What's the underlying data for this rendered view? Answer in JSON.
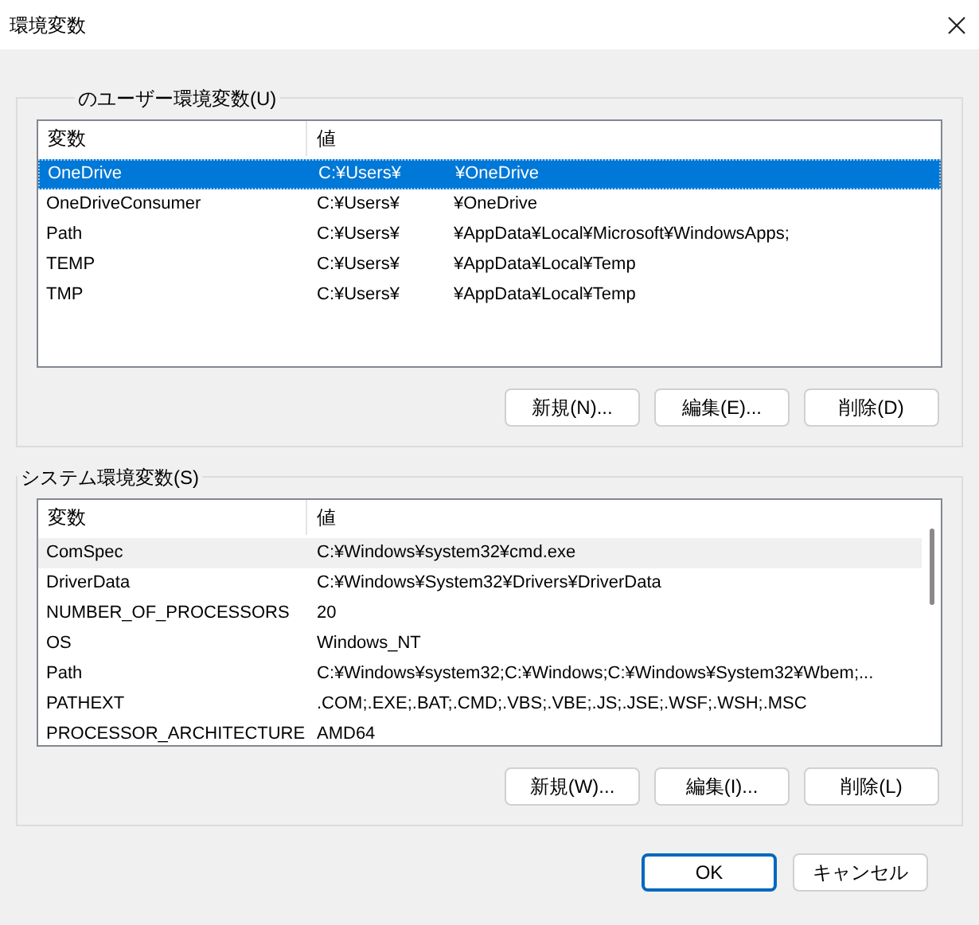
{
  "window": {
    "title": "環境変数"
  },
  "user_group": {
    "title": "のユーザー環境変数(U)",
    "columns": [
      "変数",
      "値"
    ],
    "rows": [
      {
        "name": "OneDrive",
        "value": [
          "C:¥Users¥",
          "¥OneDrive"
        ],
        "selected": true
      },
      {
        "name": "OneDriveConsumer",
        "value": [
          "C:¥Users¥",
          "¥OneDrive"
        ],
        "selected": false
      },
      {
        "name": "Path",
        "value": [
          "C:¥Users¥",
          "¥AppData¥Local¥Microsoft¥WindowsApps;"
        ],
        "selected": false
      },
      {
        "name": "TEMP",
        "value": [
          "C:¥Users¥",
          "¥AppData¥Local¥Temp"
        ],
        "selected": false
      },
      {
        "name": "TMP",
        "value": [
          "C:¥Users¥",
          "¥AppData¥Local¥Temp"
        ],
        "selected": false
      }
    ],
    "buttons": [
      "新規(N)...",
      "編集(E)...",
      "削除(D)"
    ]
  },
  "system_group": {
    "title": "システム環境変数(S)",
    "columns": [
      "変数",
      "値"
    ],
    "rows": [
      {
        "name": "ComSpec",
        "value": [
          "C:¥Windows¥system32¥cmd.exe"
        ],
        "hovered": true
      },
      {
        "name": "DriverData",
        "value": [
          "C:¥Windows¥System32¥Drivers¥DriverData"
        ],
        "hovered": false
      },
      {
        "name": "NUMBER_OF_PROCESSORS",
        "value": [
          "20"
        ],
        "hovered": false
      },
      {
        "name": "OS",
        "value": [
          "Windows_NT"
        ],
        "hovered": false
      },
      {
        "name": "Path",
        "value": [
          "C:¥Windows¥system32;C:¥Windows;C:¥Windows¥System32¥Wbem;..."
        ],
        "hovered": false
      },
      {
        "name": "PATHEXT",
        "value": [
          ".COM;.EXE;.BAT;.CMD;.VBS;.VBE;.JS;.JSE;.WSF;.WSH;.MSC"
        ],
        "hovered": false
      },
      {
        "name": "PROCESSOR_ARCHITECTURE",
        "value": [
          "AMD64"
        ],
        "hovered": false
      }
    ],
    "buttons": [
      "新規(W)...",
      "編集(I)...",
      "削除(L)"
    ]
  },
  "footer_buttons": [
    {
      "label": "OK",
      "default": true
    },
    {
      "label": "キャンセル",
      "default": false
    }
  ]
}
